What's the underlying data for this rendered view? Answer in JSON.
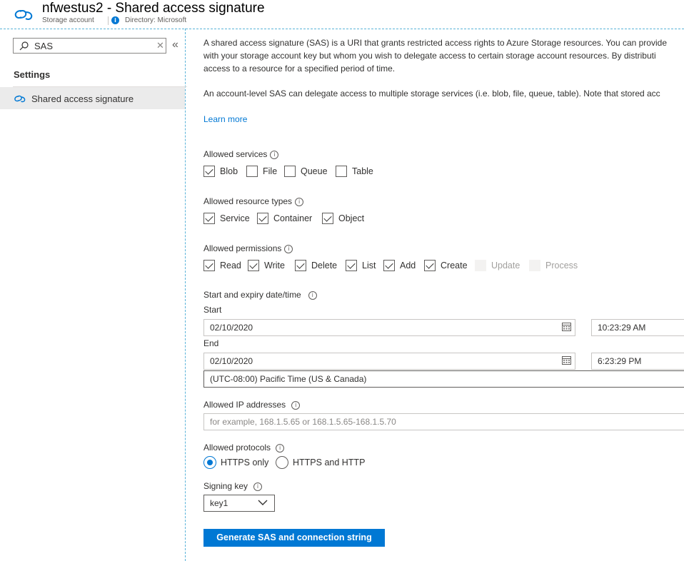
{
  "header": {
    "title": "nfwestus2 - Shared access signature",
    "resource_type": "Storage account",
    "directory": "Directory: Microsoft"
  },
  "sidebar": {
    "search_value": "SAS",
    "clear_glyph": "✕",
    "collapse_glyph": "«",
    "section_heading": "Settings",
    "items": [
      {
        "label": "Shared access signature",
        "icon": "link-icon",
        "selected": true
      }
    ]
  },
  "main": {
    "description_lines": [
      "A shared access signature (SAS) is a URI that grants restricted access rights to Azure Storage resources. You can provide",
      "with your storage account key but whom you wish to delegate access to certain storage account resources. By distributi",
      "access to a resource for a specified period of time."
    ],
    "description2": "An account-level SAS can delegate access to multiple storage services (i.e. blob, file, queue, table). Note that stored acc",
    "learn_more": "Learn more",
    "allowed_services": {
      "label": "Allowed services",
      "options": [
        {
          "label": "Blob",
          "checked": true
        },
        {
          "label": "File",
          "checked": false
        },
        {
          "label": "Queue",
          "checked": false
        },
        {
          "label": "Table",
          "checked": false
        }
      ]
    },
    "allowed_resource_types": {
      "label": "Allowed resource types",
      "options": [
        {
          "label": "Service",
          "checked": true
        },
        {
          "label": "Container",
          "checked": true
        },
        {
          "label": "Object",
          "checked": true
        }
      ]
    },
    "allowed_permissions": {
      "label": "Allowed permissions",
      "options": [
        {
          "label": "Read",
          "checked": true
        },
        {
          "label": "Write",
          "checked": true
        },
        {
          "label": "Delete",
          "checked": true
        },
        {
          "label": "List",
          "checked": true
        },
        {
          "label": "Add",
          "checked": true
        },
        {
          "label": "Create",
          "checked": true
        },
        {
          "label": "Update",
          "checked": false,
          "disabled": true
        },
        {
          "label": "Process",
          "checked": false,
          "disabled": true
        }
      ]
    },
    "datetime": {
      "label": "Start and expiry date/time",
      "start_label": "Start",
      "start_date": "02/10/2020",
      "start_time": "10:23:29 AM",
      "end_label": "End",
      "end_date": "02/10/2020",
      "end_time": "6:23:29 PM",
      "timezone": "(UTC-08:00) Pacific Time (US & Canada)"
    },
    "ip": {
      "label": "Allowed IP addresses",
      "placeholder": "for example, 168.1.5.65 or 168.1.5.65-168.1.5.70"
    },
    "protocols": {
      "label": "Allowed protocols",
      "options": [
        {
          "label": "HTTPS only",
          "selected": true
        },
        {
          "label": "HTTPS and HTTP",
          "selected": false
        }
      ]
    },
    "signing_key": {
      "label": "Signing key",
      "value": "key1"
    },
    "generate_button": "Generate SAS and connection string"
  },
  "colors": {
    "accent": "#0078d4",
    "dashed_border": "#5ab3d9",
    "selected_nav": "#ebebeb"
  }
}
